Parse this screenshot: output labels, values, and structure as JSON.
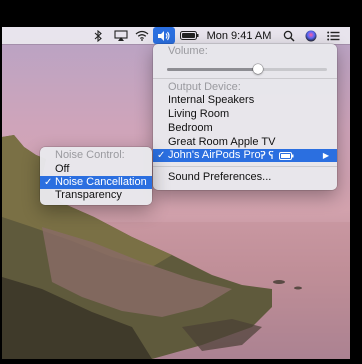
{
  "menubar": {
    "clock": "Mon 9:41 AM",
    "icons": [
      "bluetooth-icon",
      "airplay-icon",
      "wifi-icon",
      "volume-icon",
      "battery-icon",
      "search-icon",
      "siri-icon",
      "notification-center-icon"
    ]
  },
  "sound_menu": {
    "volume_label": "Volume:",
    "volume_level": 0.57,
    "output_label": "Output Device:",
    "devices": [
      {
        "label": "Internal Speakers",
        "checked": false
      },
      {
        "label": "Living Room",
        "checked": false
      },
      {
        "label": "Bedroom",
        "checked": false
      },
      {
        "label": "Great Room Apple TV",
        "checked": false
      },
      {
        "label": "John's AirPods Pro",
        "checked": true
      }
    ],
    "sound_preferences": "Sound Preferences..."
  },
  "noise_menu": {
    "header": "Noise Control:",
    "options": [
      {
        "label": "Off",
        "checked": false
      },
      {
        "label": "Noise Cancellation",
        "checked": true
      },
      {
        "label": "Transparency",
        "checked": false
      }
    ]
  },
  "colors": {
    "accent": "#2b6fe0",
    "header_text": "#9a9a9f"
  }
}
